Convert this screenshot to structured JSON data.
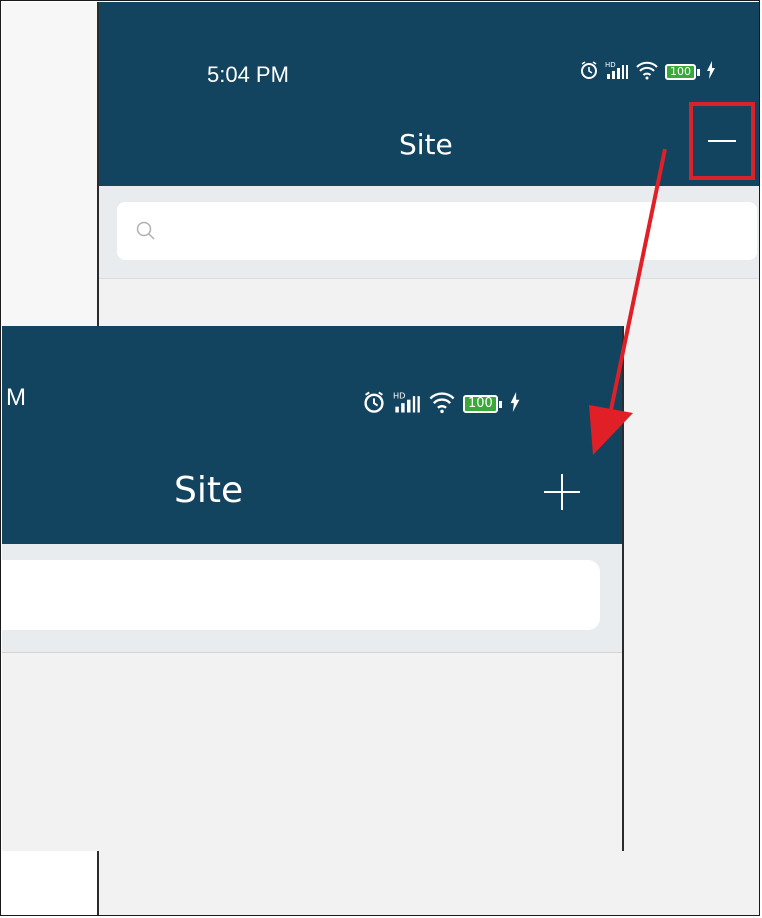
{
  "back_screen": {
    "status_bar": {
      "time": "5:04 PM",
      "battery_level": "100",
      "icons": [
        "alarm-icon",
        "hd-signal-icon",
        "wifi-icon",
        "battery-icon",
        "charging-icon"
      ]
    },
    "header": {
      "title": "Site",
      "action_icon": "minus-icon"
    },
    "search": {
      "placeholder": "",
      "icon": "search-icon"
    }
  },
  "front_screen": {
    "status_bar": {
      "time": "M",
      "battery_level": "100",
      "icons": [
        "alarm-icon",
        "hd-signal-icon",
        "wifi-icon",
        "battery-icon",
        "charging-icon"
      ]
    },
    "header": {
      "title": "Site",
      "action_icon": "plus-icon"
    },
    "search": {
      "placeholder": ""
    }
  },
  "annotation": {
    "highlight_color": "#d8232a",
    "arrow_color": "#e01f26",
    "header_color": "#12435f"
  }
}
